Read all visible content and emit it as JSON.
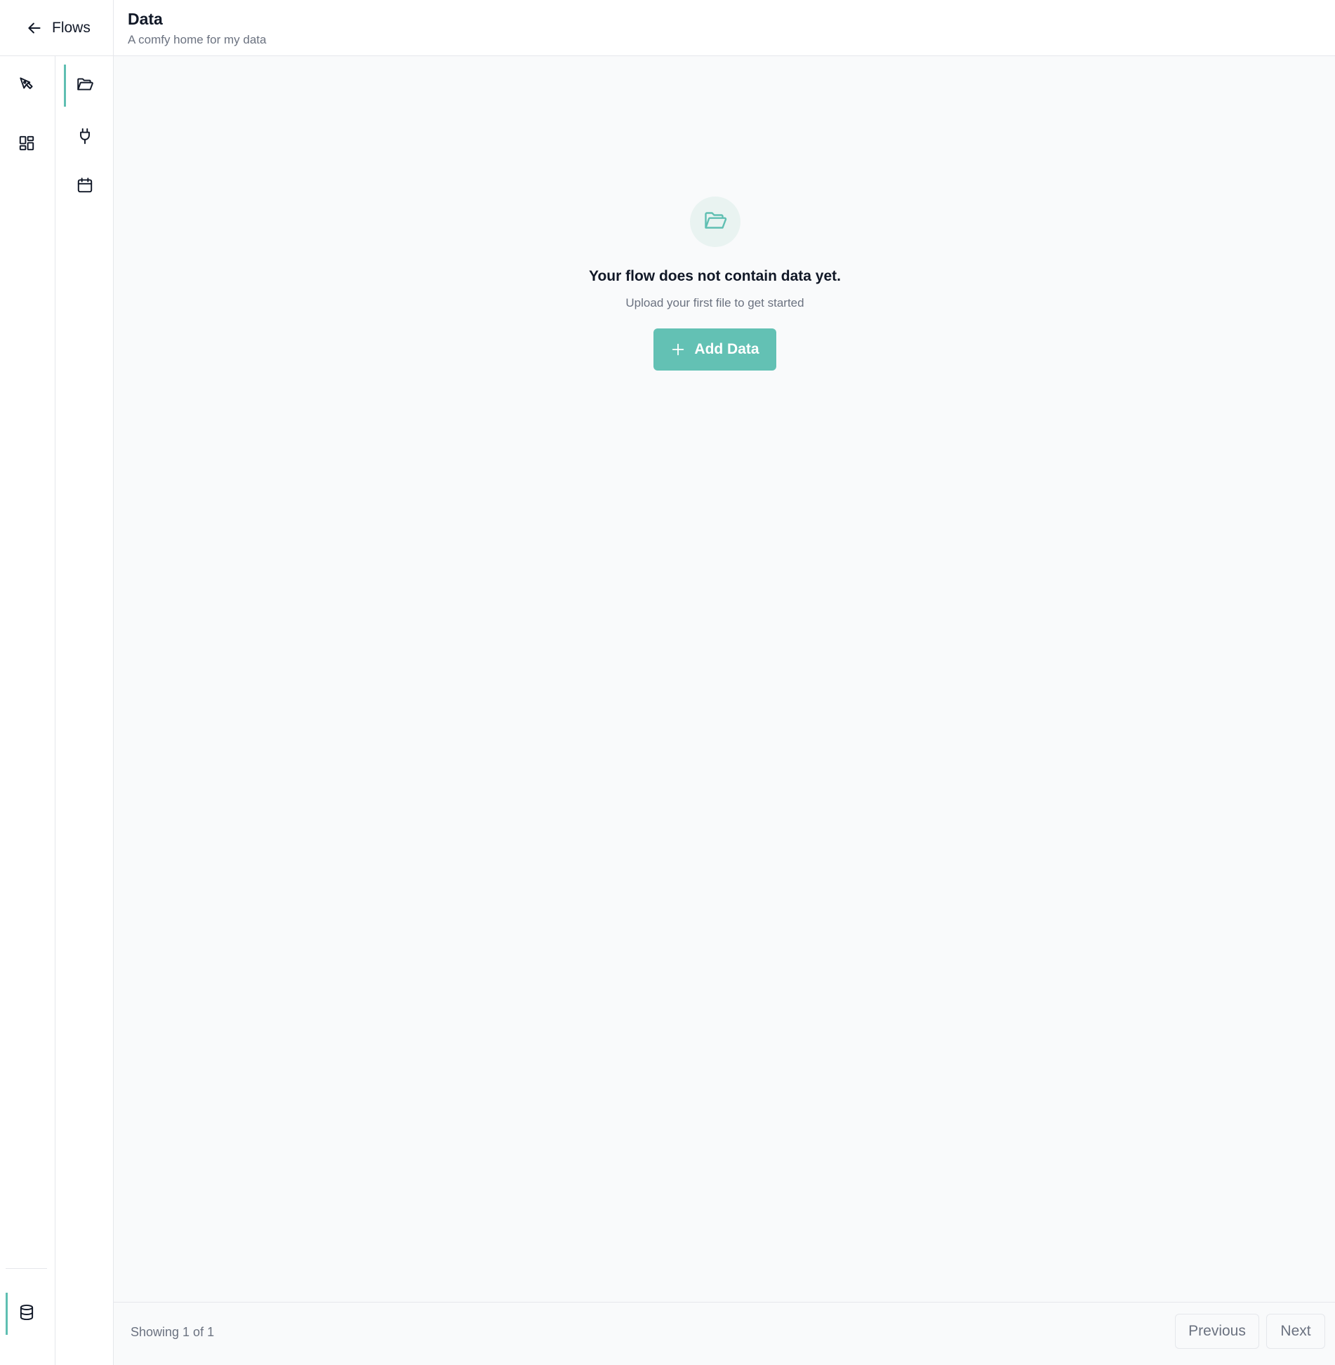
{
  "header": {
    "back_label": "Flows",
    "title": "Data",
    "subtitle": "A comfy home for my data"
  },
  "rail": {
    "items": [
      {
        "icon": "pen-tool-icon",
        "active": false
      },
      {
        "icon": "dashboard-grid-icon",
        "active": false
      }
    ],
    "bottom_item": {
      "icon": "database-icon",
      "active": true
    }
  },
  "subrail": {
    "items": [
      {
        "icon": "folder-open-icon",
        "active": true
      },
      {
        "icon": "plug-icon",
        "active": false
      },
      {
        "icon": "calendar-icon",
        "active": false
      }
    ]
  },
  "empty_state": {
    "icon": "folder-open-icon",
    "title": "Your flow does not contain data yet.",
    "subtitle": "Upload your first file to get started",
    "button_label": "Add Data"
  },
  "footer": {
    "showing_text": "Showing 1 of 1",
    "previous_label": "Previous",
    "next_label": "Next"
  },
  "colors": {
    "accent": "#63c1b4",
    "accent_light": "#e9f3f1",
    "border": "#e5e7eb",
    "muted_text": "#6b7280",
    "main_bg": "#f9fafb"
  }
}
